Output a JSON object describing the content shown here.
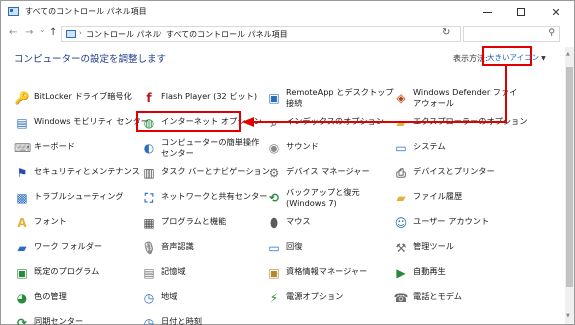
{
  "window": {
    "title": "すべてのコントロール パネル項目",
    "min_icon": "minimize-icon",
    "max_icon": "maximize-icon",
    "close_icon": "close-icon",
    "close_glyph": "✕"
  },
  "nav": {
    "back_glyph": "←",
    "forward_glyph": "→",
    "recent_glyph": "⌄",
    "up_glyph": "↑",
    "breadcrumb": [
      "コントロール パネル",
      "すべてのコントロール パネル項目"
    ],
    "sep_glyph": "›",
    "dd_glyph": "⌄",
    "refresh_glyph": "↻",
    "search_glyph": "⚲",
    "search_placeholder": ""
  },
  "header": {
    "title": "コンピューターの設定を調整します",
    "view_label": "表示方法:",
    "view_value": "大きいアイコン",
    "caret": "▼"
  },
  "items": [
    {
      "label": "BitLocker ドライブ暗号化",
      "icon": "bitlocker-icon",
      "color": "#8a8a8a",
      "glyph": "🔑"
    },
    {
      "label": "Flash Player (32 ビット)",
      "icon": "flash-player-icon",
      "color": "#b31b1b",
      "glyph": "f"
    },
    {
      "label": "RemoteApp とデスクトップ接続",
      "icon": "remoteapp-icon",
      "color": "#2a6ebd",
      "glyph": "▣"
    },
    {
      "label": "Windows Defender ファイアウォール",
      "icon": "firewall-icon",
      "color": "#b44b12",
      "glyph": "◈"
    },
    {
      "label": "Windows モビリティ センター",
      "icon": "mobility-center-icon",
      "color": "#2a6ebd",
      "glyph": "▤"
    },
    {
      "label": "インターネット オプション",
      "icon": "internet-options-icon",
      "color": "#2a8a3c",
      "glyph": "◍"
    },
    {
      "label": "インデックスのオプション",
      "icon": "indexing-options-icon",
      "color": "#7a7a7a",
      "glyph": "⌕"
    },
    {
      "label": "エクスプローラーのオプション",
      "icon": "explorer-options-icon",
      "color": "#e2b23a",
      "glyph": "▰"
    },
    {
      "label": "キーボード",
      "icon": "keyboard-icon",
      "color": "#7a7a7a",
      "glyph": "⌨"
    },
    {
      "label": "コンピューターの簡単操作センター",
      "icon": "ease-of-access-icon",
      "color": "#2a6ebd",
      "glyph": "◐"
    },
    {
      "label": "サウンド",
      "icon": "sound-icon",
      "color": "#8a8a8a",
      "glyph": "◉"
    },
    {
      "label": "システム",
      "icon": "system-icon",
      "color": "#2a6ebd",
      "glyph": "▭"
    },
    {
      "label": "セキュリティとメンテナンス",
      "icon": "security-maintenance-icon",
      "color": "#2a4fa0",
      "glyph": "⚑"
    },
    {
      "label": "タスク バーとナビゲーション",
      "icon": "taskbar-icon",
      "color": "#4a4a4a",
      "glyph": "▥"
    },
    {
      "label": "デバイス マネージャー",
      "icon": "device-manager-icon",
      "color": "#6a6a6a",
      "glyph": "⚙"
    },
    {
      "label": "デバイスとプリンター",
      "icon": "devices-printers-icon",
      "color": "#6a6a6a",
      "glyph": "⎙"
    },
    {
      "label": "トラブルシューティング",
      "icon": "troubleshooting-icon",
      "color": "#2a6ebd",
      "glyph": "▩"
    },
    {
      "label": "ネットワークと共有センター",
      "icon": "network-sharing-icon",
      "color": "#2a6ebd",
      "glyph": "⛶"
    },
    {
      "label": "バックアップと復元 (Windows 7)",
      "icon": "backup-restore-icon",
      "color": "#2a8a3c",
      "glyph": "⟲"
    },
    {
      "label": "ファイル履歴",
      "icon": "file-history-icon",
      "color": "#e2b23a",
      "glyph": "▰"
    },
    {
      "label": "フォント",
      "icon": "fonts-icon",
      "color": "#e2b23a",
      "glyph": "A"
    },
    {
      "label": "プログラムと機能",
      "icon": "programs-features-icon",
      "color": "#4a4a4a",
      "glyph": "▦"
    },
    {
      "label": "マウス",
      "icon": "mouse-icon",
      "color": "#5a5a5a",
      "glyph": "⬮"
    },
    {
      "label": "ユーザー アカウント",
      "icon": "user-accounts-icon",
      "color": "#2a6ebd",
      "glyph": "☺"
    },
    {
      "label": "ワーク フォルダー",
      "icon": "work-folders-icon",
      "color": "#2a6ebd",
      "glyph": "▰"
    },
    {
      "label": "音声認識",
      "icon": "speech-recognition-icon",
      "color": "#8a8a8a",
      "glyph": "🎙"
    },
    {
      "label": "回復",
      "icon": "recovery-icon",
      "color": "#2a6ebd",
      "glyph": "▭"
    },
    {
      "label": "管理ツール",
      "icon": "admin-tools-icon",
      "color": "#6a6a6a",
      "glyph": "⚒"
    },
    {
      "label": "既定のプログラム",
      "icon": "default-programs-icon",
      "color": "#2a8a3c",
      "glyph": "▣"
    },
    {
      "label": "記憶域",
      "icon": "storage-spaces-icon",
      "color": "#7a7a7a",
      "glyph": "▤"
    },
    {
      "label": "資格情報マネージャー",
      "icon": "credential-manager-icon",
      "color": "#b8862b",
      "glyph": "▣"
    },
    {
      "label": "自動再生",
      "icon": "autoplay-icon",
      "color": "#2a8a3c",
      "glyph": "▶"
    },
    {
      "label": "色の管理",
      "icon": "color-management-icon",
      "color": "#2a8a3c",
      "glyph": "◕"
    },
    {
      "label": "地域",
      "icon": "region-icon",
      "color": "#2a6ebd",
      "glyph": "◷"
    },
    {
      "label": "電源オプション",
      "icon": "power-options-icon",
      "color": "#2a8a3c",
      "glyph": "⚡"
    },
    {
      "label": "電話とモデム",
      "icon": "phone-modem-icon",
      "color": "#6a6a6a",
      "glyph": "☎"
    },
    {
      "label": "同期センター",
      "icon": "sync-center-icon",
      "color": "#2a8a3c",
      "glyph": "⟳"
    },
    {
      "label": "日付と時刻",
      "icon": "date-time-icon",
      "color": "#2a6ebd",
      "glyph": "◷"
    }
  ],
  "colors": {
    "annotation_red": "#e00000",
    "title_blue": "#1e3a8a",
    "link_blue": "#1f5fbf"
  }
}
